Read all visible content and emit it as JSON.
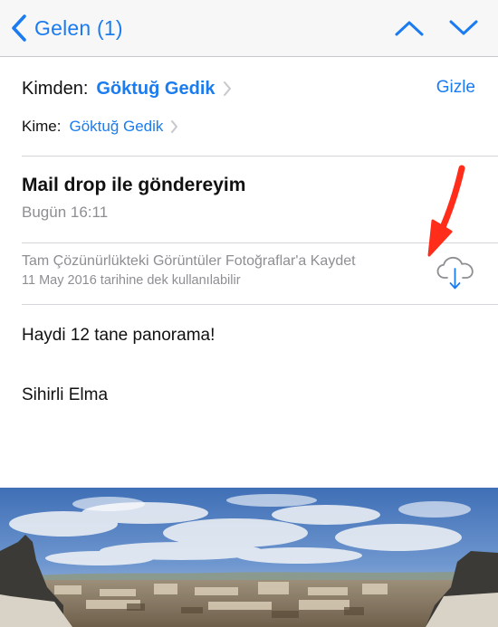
{
  "nav": {
    "back_label": "Gelen (1)",
    "back_icon": "chevron-left-icon",
    "prev_icon": "chevron-up-icon",
    "next_icon": "chevron-down-icon"
  },
  "header": {
    "from_label": "Kimden:",
    "from_name": "Göktuğ Gedik",
    "hide_label": "Gizle",
    "to_label": "Kime:",
    "to_name": "Göktuğ Gedik"
  },
  "message": {
    "subject": "Mail drop ile göndereyim",
    "date": "Bugün 16:11"
  },
  "mail_drop": {
    "save_label": "Tam Çözünürlükteki Görüntüler Fotoğraflar'a Kaydet",
    "expiry": "11 May 2016 tarihine dek kullanılabilir",
    "icon": "cloud-download-icon"
  },
  "body": {
    "line1": "Haydi 12 tane panorama!",
    "line2": "Sihirli Elma"
  },
  "colors": {
    "accent": "#1a7cf0",
    "secondary_text": "#8e8e93",
    "annotation_arrow": "#ff2d1a"
  }
}
